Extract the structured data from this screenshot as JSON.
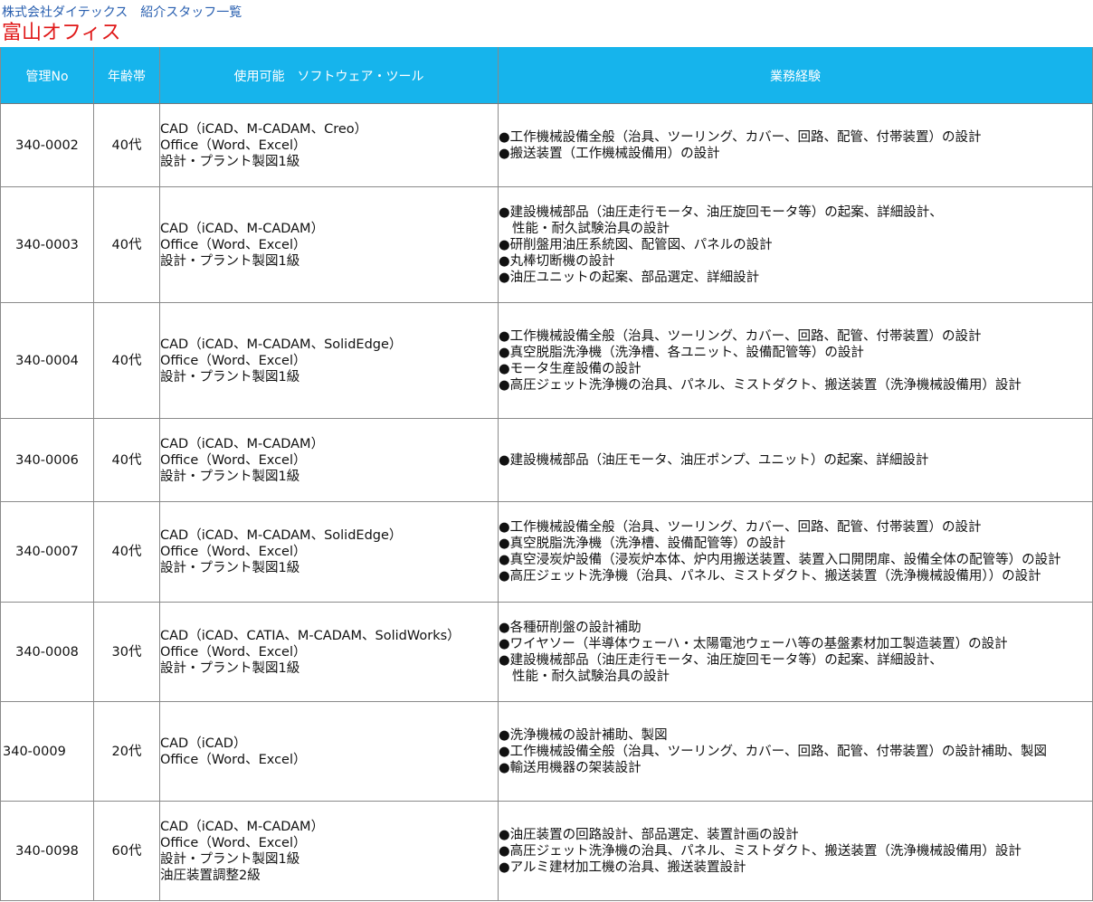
{
  "header": {
    "company": "株式会社ダイテックス　紹介スタッフ一覧",
    "office": "富山オフィス"
  },
  "colors": {
    "header_bg": "#16b4ec",
    "company_text": "#2a60b0",
    "office_text": "#e01818"
  },
  "table": {
    "columns": {
      "no": "管理No",
      "age": "年齢帯",
      "software": "使用可能　ソフトウェア・ツール",
      "experience": "業務経験"
    },
    "rows": [
      {
        "no": "340-0002",
        "age": "40代",
        "software": [
          "CAD（iCAD、M-CADAM、Creo）",
          "Office（Word、Excel）",
          "設計・プラント製図1級"
        ],
        "experience": [
          "●工作機械設備全般（治具、ツーリング、カバー、回路、配管、付帯装置）の設計",
          "●搬送装置（工作機械設備用）の設計"
        ]
      },
      {
        "no": "340-0003",
        "age": "40代",
        "software": [
          "CAD（iCAD、M-CADAM）",
          "Office（Word、Excel）",
          "設計・プラント製図1級"
        ],
        "experience": [
          "●建設機械部品（油圧走行モータ、油圧旋回モータ等）の起案、詳細設計、",
          "性能・耐久試験治具の設計",
          "●研削盤用油圧系統図、配管図、パネルの設計",
          "●丸棒切断機の設計",
          "●油圧ユニットの起案、部品選定、詳細設計"
        ]
      },
      {
        "no": "340-0004",
        "age": "40代",
        "software": [
          "CAD（iCAD、M-CADAM、SolidEdge）",
          "Office（Word、Excel）",
          "設計・プラント製図1級"
        ],
        "experience": [
          "●工作機械設備全般（治具、ツーリング、カバー、回路、配管、付帯装置）の設計",
          "●真空脱脂洗浄機（洗浄槽、各ユニット、設備配管等）の設計",
          "●モータ生産設備の設計",
          "●高圧ジェット洗浄機の治具、パネル、ミストダクト、搬送装置（洗浄機械設備用）設計"
        ]
      },
      {
        "no": "340-0006",
        "age": "40代",
        "software": [
          "CAD（iCAD、M-CADAM）",
          "Office（Word、Excel）",
          "設計・プラント製図1級"
        ],
        "experience": [
          "●建設機械部品（油圧モータ、油圧ポンプ、ユニット）の起案、詳細設計"
        ]
      },
      {
        "no": "340-0007",
        "age": "40代",
        "software": [
          "CAD（iCAD、M-CADAM、SolidEdge）",
          "Office（Word、Excel）",
          "設計・プラント製図1級"
        ],
        "experience": [
          "●工作機械設備全般（治具、ツーリング、カバー、回路、配管、付帯装置）の設計",
          "●真空脱脂洗浄機（洗浄槽、設備配管等）の設計",
          "●真空浸炭炉設備（浸炭炉本体、炉内用搬送装置、装置入口開閉扉、設備全体の配管等）の設計",
          "●高圧ジェット洗浄機（治具、パネル、ミストダクト、搬送装置（洗浄機械設備用））の設計"
        ]
      },
      {
        "no": "340-0008",
        "age": "30代",
        "software": [
          "CAD（iCAD、CATIA、M-CADAM、SolidWorks）",
          "Office（Word、Excel）",
          "設計・プラント製図1級"
        ],
        "experience": [
          "●各種研削盤の設計補助",
          "●ワイヤソー（半導体ウェーハ・太陽電池ウェーハ等の基盤素材加工製造装置）の設計",
          "●建設機械部品（油圧走行モータ、油圧旋回モータ等）の起案、詳細設計、",
          "性能・耐久試験治具の設計"
        ]
      },
      {
        "no": "340-0009",
        "age": "20代",
        "software": [
          "CAD（iCAD）",
          "Office（Word、Excel）"
        ],
        "experience": [
          "●洗浄機械の設計補助、製図",
          "●工作機械設備全般（治具、ツーリング、カバー、回路、配管、付帯装置）の設計補助、製図",
          "●輸送用機器の架装設計"
        ]
      },
      {
        "no": "340-0098",
        "age": "60代",
        "software": [
          "CAD（iCAD、M-CADAM）",
          "Office（Word、Excel）",
          "設計・プラント製図1級",
          "油圧装置調整2級"
        ],
        "experience": [
          "●油圧装置の回路設計、部品選定、装置計画の設計",
          "●高圧ジェット洗浄機の治具、パネル、ミストダクト、搬送装置（洗浄機械設備用）設計",
          "●アルミ建材加工機の治具、搬送装置設計"
        ]
      }
    ]
  }
}
